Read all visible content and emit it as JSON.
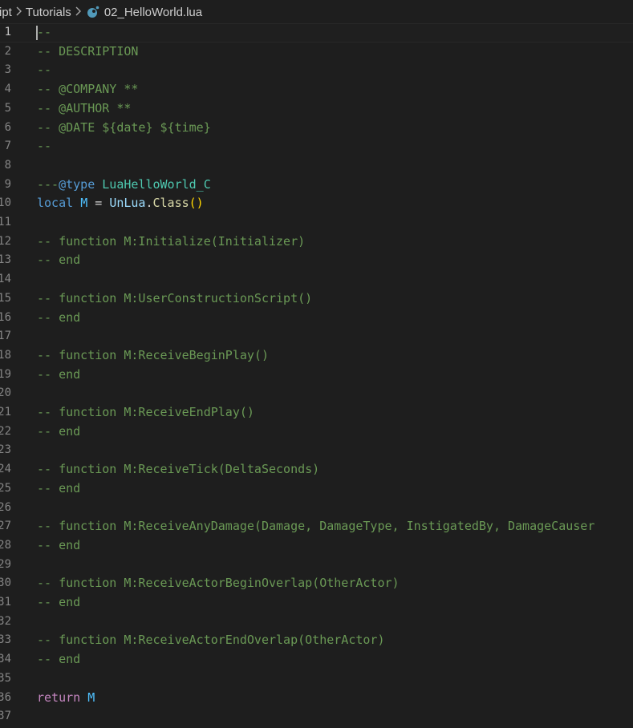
{
  "breadcrumb": {
    "segments": [
      "ript",
      "Tutorials",
      "02_HelloWorld.lua"
    ],
    "file_icon": "lua-file-icon"
  },
  "editor": {
    "current_line": 1,
    "lines": [
      {
        "n": "1",
        "tokens": [
          [
            "c",
            "--"
          ]
        ]
      },
      {
        "n": "2",
        "tokens": [
          [
            "c",
            "-- DESCRIPTION"
          ]
        ]
      },
      {
        "n": "3",
        "tokens": [
          [
            "c",
            "--"
          ]
        ]
      },
      {
        "n": "4",
        "tokens": [
          [
            "c",
            "-- @COMPANY **"
          ]
        ]
      },
      {
        "n": "5",
        "tokens": [
          [
            "c",
            "-- @AUTHOR **"
          ]
        ]
      },
      {
        "n": "6",
        "tokens": [
          [
            "c",
            "-- @DATE ${date} ${time}"
          ]
        ]
      },
      {
        "n": "7",
        "tokens": [
          [
            "c",
            "--"
          ]
        ]
      },
      {
        "n": "8",
        "tokens": []
      },
      {
        "n": "9",
        "tokens": [
          [
            "c",
            "---"
          ],
          [
            "kw",
            "@type"
          ],
          [
            "op",
            " "
          ],
          [
            "ty",
            "LuaHelloWorld_C"
          ]
        ]
      },
      {
        "n": "10",
        "tokens": [
          [
            "kw",
            "local"
          ],
          [
            "op",
            " "
          ],
          [
            "var",
            "M"
          ],
          [
            "op",
            " = "
          ],
          [
            "id",
            "UnLua"
          ],
          [
            "op",
            "."
          ],
          [
            "fn",
            "Class"
          ],
          [
            "br",
            "()"
          ]
        ]
      },
      {
        "n": "11",
        "tokens": []
      },
      {
        "n": "12",
        "tokens": [
          [
            "c",
            "-- function M:Initialize(Initializer)"
          ]
        ]
      },
      {
        "n": "13",
        "tokens": [
          [
            "c",
            "-- end"
          ]
        ]
      },
      {
        "n": "14",
        "tokens": []
      },
      {
        "n": "15",
        "tokens": [
          [
            "c",
            "-- function M:UserConstructionScript()"
          ]
        ]
      },
      {
        "n": "16",
        "tokens": [
          [
            "c",
            "-- end"
          ]
        ]
      },
      {
        "n": "17",
        "tokens": []
      },
      {
        "n": "18",
        "tokens": [
          [
            "c",
            "-- function M:ReceiveBeginPlay()"
          ]
        ]
      },
      {
        "n": "19",
        "tokens": [
          [
            "c",
            "-- end"
          ]
        ]
      },
      {
        "n": "20",
        "tokens": []
      },
      {
        "n": "21",
        "tokens": [
          [
            "c",
            "-- function M:ReceiveEndPlay()"
          ]
        ]
      },
      {
        "n": "22",
        "tokens": [
          [
            "c",
            "-- end"
          ]
        ]
      },
      {
        "n": "23",
        "tokens": []
      },
      {
        "n": "24",
        "tokens": [
          [
            "c",
            "-- function M:ReceiveTick(DeltaSeconds)"
          ]
        ]
      },
      {
        "n": "25",
        "tokens": [
          [
            "c",
            "-- end"
          ]
        ]
      },
      {
        "n": "26",
        "tokens": []
      },
      {
        "n": "27",
        "tokens": [
          [
            "c",
            "-- function M:ReceiveAnyDamage(Damage, DamageType, InstigatedBy, DamageCauser"
          ]
        ]
      },
      {
        "n": "28",
        "tokens": [
          [
            "c",
            "-- end"
          ]
        ]
      },
      {
        "n": "29",
        "tokens": []
      },
      {
        "n": "30",
        "tokens": [
          [
            "c",
            "-- function M:ReceiveActorBeginOverlap(OtherActor)"
          ]
        ]
      },
      {
        "n": "31",
        "tokens": [
          [
            "c",
            "-- end"
          ]
        ]
      },
      {
        "n": "32",
        "tokens": []
      },
      {
        "n": "33",
        "tokens": [
          [
            "c",
            "-- function M:ReceiveActorEndOverlap(OtherActor)"
          ]
        ]
      },
      {
        "n": "34",
        "tokens": [
          [
            "c",
            "-- end"
          ]
        ]
      },
      {
        "n": "35",
        "tokens": []
      },
      {
        "n": "36",
        "tokens": [
          [
            "ret",
            "return"
          ],
          [
            "op",
            " "
          ],
          [
            "var",
            "M"
          ]
        ]
      },
      {
        "n": "37",
        "tokens": []
      }
    ]
  }
}
